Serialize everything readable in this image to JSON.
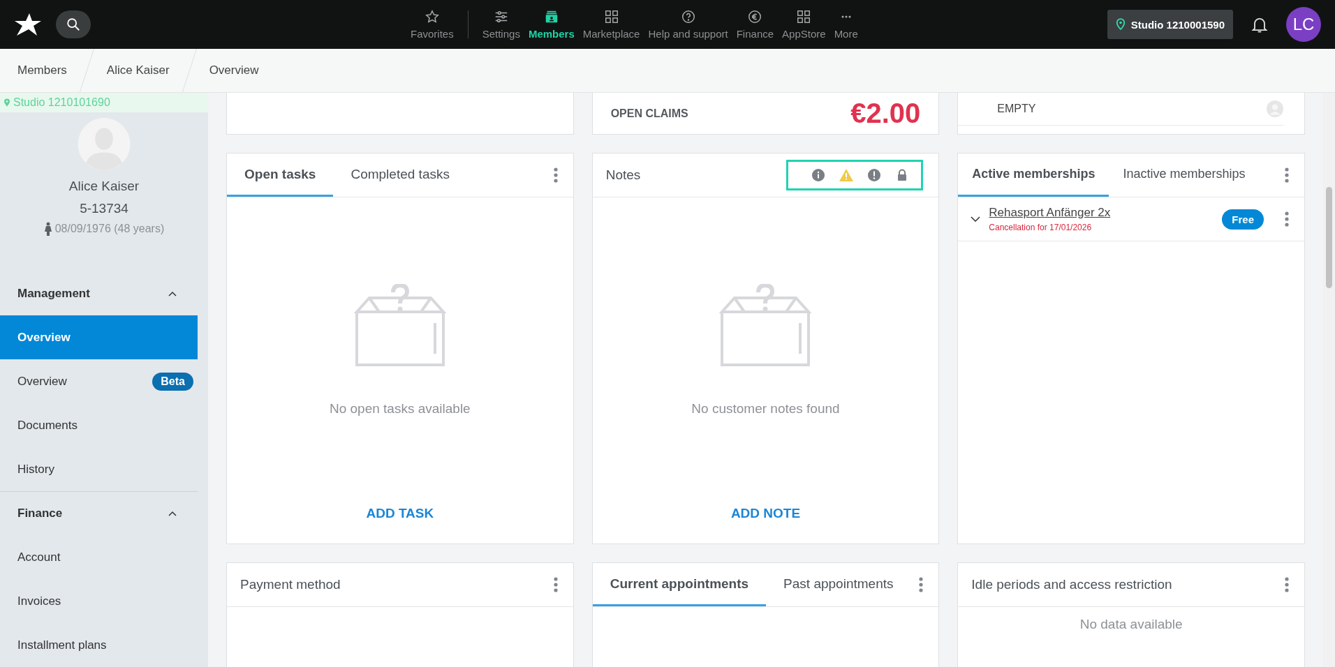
{
  "topbar": {
    "nav": [
      {
        "label": "Favorites",
        "kind": "star",
        "selected": false
      },
      {
        "label": "Settings",
        "kind": "sliders",
        "selected": false
      },
      {
        "label": "Members",
        "kind": "members",
        "selected": true
      },
      {
        "label": "Marketplace",
        "kind": "grid",
        "selected": false
      },
      {
        "label": "Help and support",
        "kind": "help",
        "selected": false
      },
      {
        "label": "Finance",
        "kind": "euro",
        "selected": false
      },
      {
        "label": "AppStore",
        "kind": "grid",
        "selected": false
      },
      {
        "label": "More",
        "kind": "dots",
        "selected": false
      }
    ],
    "studio": "Studio 1210001590",
    "avatar": "LC"
  },
  "breadcrumb": [
    "Members",
    "Alice Kaiser",
    "Overview"
  ],
  "sidebar": {
    "studio": "Studio 1210101690",
    "name": "Alice Kaiser",
    "member_id": "5-13734",
    "birth": "08/09/1976 (48 years)",
    "sections": [
      {
        "title": "Management",
        "expanded": true,
        "items": [
          {
            "label": "Overview",
            "selected": true
          },
          {
            "label": "Overview",
            "selected": false,
            "badge": "Beta"
          },
          {
            "label": "Documents",
            "selected": false
          },
          {
            "label": "History",
            "selected": false
          }
        ]
      },
      {
        "title": "Finance",
        "expanded": true,
        "items": [
          {
            "label": "Account",
            "selected": false
          },
          {
            "label": "Invoices",
            "selected": false
          },
          {
            "label": "Installment plans",
            "selected": false
          }
        ]
      }
    ]
  },
  "top_cards": {
    "claims_label": "OPEN CLAIMS",
    "claims_amount": "€2.00",
    "status": "EMPTY"
  },
  "tasks": {
    "tabs": [
      {
        "label": "Open tasks",
        "selected": true
      },
      {
        "label": "Completed tasks",
        "selected": false
      }
    ],
    "empty": "No open tasks available",
    "action": "ADD TASK"
  },
  "notes": {
    "title": "Notes",
    "filters": [
      {
        "kind": "info"
      },
      {
        "kind": "warning"
      },
      {
        "kind": "alert"
      },
      {
        "kind": "lock"
      }
    ],
    "empty": "No customer notes found",
    "action": "ADD NOTE"
  },
  "memberships": {
    "tabs": [
      {
        "label": "Active memberships",
        "selected": true
      },
      {
        "label": "Inactive memberships",
        "selected": false
      }
    ],
    "items": [
      {
        "name": "Rehasport Anfänger 2x",
        "note": "Cancellation for 17/01/2026",
        "badge": "Free",
        "expanded": false
      }
    ]
  },
  "payment": {
    "title": "Payment method"
  },
  "appointments": {
    "tabs": [
      {
        "label": "Current appointments",
        "selected": true
      },
      {
        "label": "Past appointments",
        "selected": false
      }
    ]
  },
  "idle": {
    "title": "Idle periods and access restriction",
    "empty": "No data available"
  }
}
